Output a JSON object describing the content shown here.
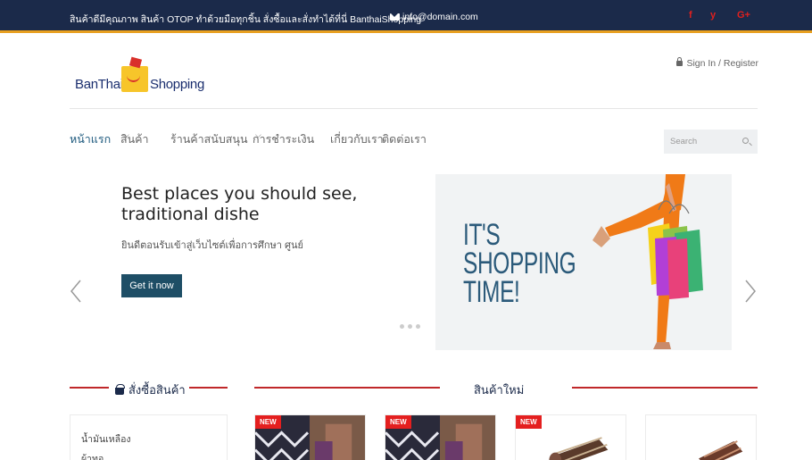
{
  "topbar": {
    "message": "สินค้าดีมีคุณภาพ สินค้า OTOP ทำด้วยมือทุกชิ้น สั่งซื้อและสั่งทำได้ที่นี่ BanthaiShopping",
    "email": "info@domain.com",
    "social": [
      "f",
      "y",
      "G+"
    ]
  },
  "brand": {
    "part1": "BanThai",
    "part2": "Shopping"
  },
  "account": {
    "label": "Sign In / Register"
  },
  "nav": {
    "items": [
      {
        "label": "หน้าแรก"
      },
      {
        "label": "สินค้า"
      },
      {
        "label": "ร้านค้าสนับสนุน"
      },
      {
        "label": "การชำระเงิน"
      },
      {
        "label": "เกี่ยวกับเรา"
      },
      {
        "label": "ติดต่อเรา"
      }
    ],
    "dropdown_marker": "⌵"
  },
  "search": {
    "placeholder": "Search"
  },
  "hero": {
    "title": "Best places you should see, traditional dishe",
    "subtitle": "ยินดีตอนรับเข้าสู่เว็บไซต์เพื่อการศึกษา ศูนย์",
    "button": "Get it now",
    "banner_text": [
      "IT'S",
      "SHOPPING",
      "TIME!"
    ]
  },
  "sections": {
    "order_title": "สั่งซื้อสินค้า",
    "new_title": "สินค้าใหม่"
  },
  "categories": [
    "น้ำมันเหลือง",
    "ผ้าทอ"
  ],
  "products": [
    {
      "badge": "NEW"
    },
    {
      "badge": "NEW"
    },
    {
      "badge": "NEW"
    },
    {
      "badge": ""
    }
  ],
  "colors": {
    "topbar": "#1b2a4a",
    "accent": "#c0282a",
    "button": "#1e4e66",
    "gold": "#e8a020"
  }
}
